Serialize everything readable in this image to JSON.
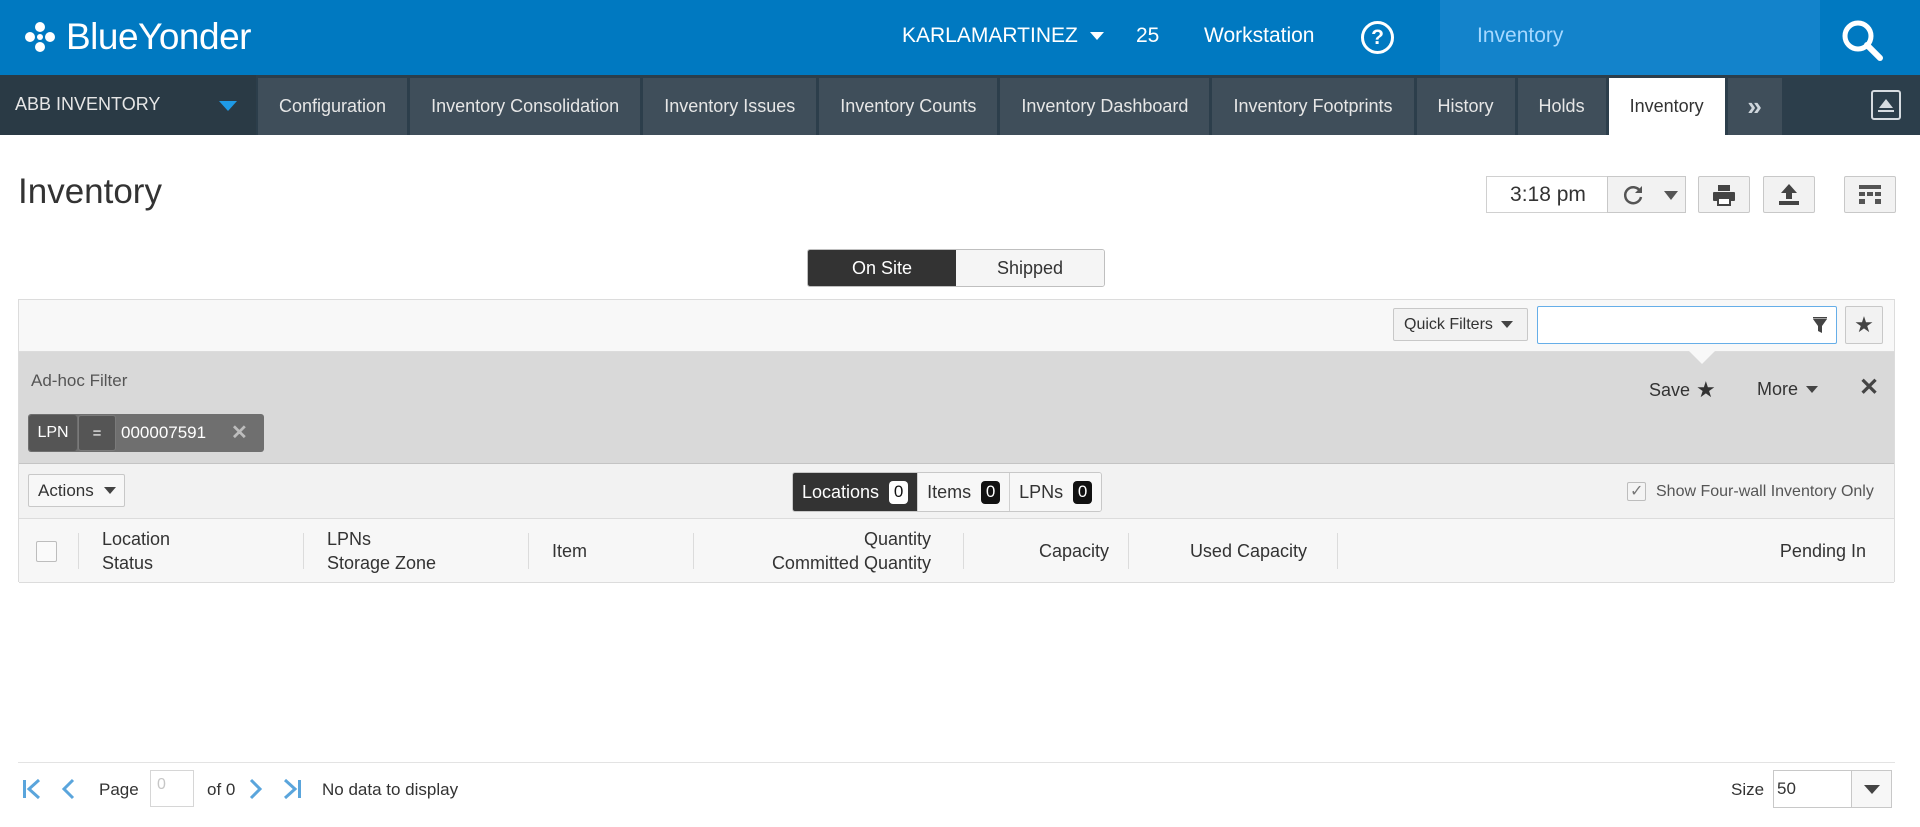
{
  "brand": {
    "name": "BlueYonder"
  },
  "topbar": {
    "user": "KARLAMARTINEZ",
    "count": "25",
    "workstation": "Workstation",
    "help": "?",
    "active_app": "Inventory"
  },
  "nav": {
    "app_select": "ABB INVENTORY",
    "tabs": [
      {
        "label": "Configuration"
      },
      {
        "label": "Inventory Consolidation"
      },
      {
        "label": "Inventory Issues"
      },
      {
        "label": "Inventory Counts"
      },
      {
        "label": "Inventory Dashboard"
      },
      {
        "label": "Inventory Footprints"
      },
      {
        "label": "History"
      },
      {
        "label": "Holds"
      },
      {
        "label": "Inventory"
      }
    ],
    "more": "»",
    "active_index": 8
  },
  "page": {
    "title": "Inventory",
    "clock": "3:18 pm"
  },
  "segment": {
    "options": [
      "On Site",
      "Shipped"
    ],
    "selected": "On Site"
  },
  "filters": {
    "quick_filters": "Quick Filters",
    "filter_value": "",
    "adhoc_title": "Ad-hoc Filter",
    "save": "Save",
    "more": "More",
    "chip": {
      "field": "LPN",
      "operator": "=",
      "value": "000007591"
    }
  },
  "toolbar": {
    "actions": "Actions",
    "tabs": [
      {
        "label": "Locations",
        "count": "0"
      },
      {
        "label": "Items",
        "count": "0"
      },
      {
        "label": "LPNs",
        "count": "0"
      }
    ],
    "four_wall": "Show Four-wall Inventory Only",
    "four_wall_checked": true
  },
  "grid": {
    "columns": [
      {
        "line1": "Location",
        "line2": "Status"
      },
      {
        "line1": "LPNs",
        "line2": "Storage Zone"
      },
      {
        "line1": "Item",
        "line2": ""
      },
      {
        "line1": "Quantity",
        "line2": "Committed Quantity"
      },
      {
        "line1": "Capacity",
        "line2": ""
      },
      {
        "line1": "Used Capacity",
        "line2": ""
      },
      {
        "line1": "Pending In",
        "line2": ""
      }
    ],
    "rows": []
  },
  "pager": {
    "page_label": "Page",
    "page_value": "0",
    "of_label": "of 0",
    "status": "No data to display",
    "size_label": "Size",
    "size_value": "50"
  },
  "colors": {
    "brand_blue": "#0079c1",
    "nav_dark": "#2c3e4b",
    "active_app_text": "#a6d8ff"
  }
}
